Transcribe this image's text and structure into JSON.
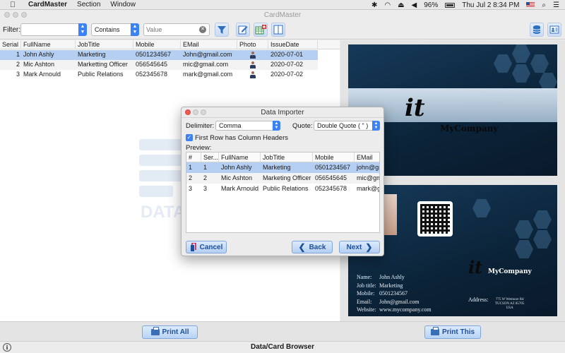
{
  "menubar": {
    "apple_icon": "apple-icon",
    "app_name": "CardMaster",
    "menus": [
      "Section",
      "Window"
    ],
    "battery_percent": "96%",
    "clock": "Thu Jul 2  8:34 PM"
  },
  "window": {
    "title": "CardMaster"
  },
  "toolbar": {
    "filter_label": "Filter:",
    "filter_field_value": "",
    "operator_value": "Contains",
    "value_placeholder": "Value"
  },
  "table": {
    "columns": [
      "Serial",
      "FullName",
      "JobTitle",
      "Mobile",
      "EMail",
      "Photo",
      "IssueDate"
    ],
    "rows": [
      {
        "serial": "1",
        "fullname": "John Ashly",
        "jobtitle": "Marketing",
        "mobile": "0501234567",
        "email": "John@gmail.com",
        "issuedate": "2020-07-01"
      },
      {
        "serial": "2",
        "fullname": "Mic Ashton",
        "jobtitle": "Marketting Officer",
        "mobile": "056545645",
        "email": "mic@gmail.com",
        "issuedate": "2020-07-02"
      },
      {
        "serial": "3",
        "fullname": "Mark Arnould",
        "jobtitle": "Public Relations",
        "mobile": "052345678",
        "email": "mark@gmail.com",
        "issuedate": "2020-07-02"
      }
    ],
    "watermark_text": "DATA"
  },
  "card": {
    "company": "MyCompany",
    "logo_mark": "it",
    "info": [
      {
        "key": "Name:",
        "value": "John Ashly"
      },
      {
        "key": "Job title:",
        "value": "Marketing"
      },
      {
        "key": "Mobile:",
        "value": "0501234567"
      },
      {
        "key": "Email:",
        "value": "John@gmail.com"
      },
      {
        "key": "Website:",
        "value": "www.mycompany.com"
      }
    ],
    "address_label": "Address:",
    "address_lines": [
      "775 W Wetmore Rd",
      "TUCSON AZ 85705",
      "USA"
    ]
  },
  "buttons": {
    "print_all": "Print All",
    "print_this": "Print This"
  },
  "status": {
    "text": "Data/Card Browser"
  },
  "dialog": {
    "title": "Data Importer",
    "delimiter_label": "Delimiter:",
    "delimiter_value": "Comma",
    "quote_label": "Quote:",
    "quote_value": "Double Quote ( \" )",
    "header_checkbox_label": "First Row has Column Headers",
    "header_checked": true,
    "preview_label": "Preview:",
    "preview_columns": [
      "#",
      "Ser...",
      "FullName",
      "JobTitle",
      "Mobile",
      "EMail"
    ],
    "preview_rows": [
      {
        "n": "1",
        "serial": "1",
        "fullname": "John Ashly",
        "jobtitle": "Marketing",
        "mobile": "0501234567",
        "email": "john@gmail.com"
      },
      {
        "n": "2",
        "serial": "2",
        "fullname": "Mic Ashton",
        "jobtitle": "Marketing Officer",
        "mobile": "056545645",
        "email": "mic@gmail.com"
      },
      {
        "n": "3",
        "serial": "3",
        "fullname": "Mark Arnould",
        "jobtitle": "Public Relations",
        "mobile": "052345678",
        "email": "mark@gmail.com"
      }
    ],
    "cancel_label": "Cancel",
    "back_label": "Back",
    "next_label": "Next"
  },
  "colors": {
    "accent": "#3b82f6",
    "selection": "#b5cff2",
    "button_text": "#1d4f9a",
    "card_bg": "#0b2338"
  }
}
